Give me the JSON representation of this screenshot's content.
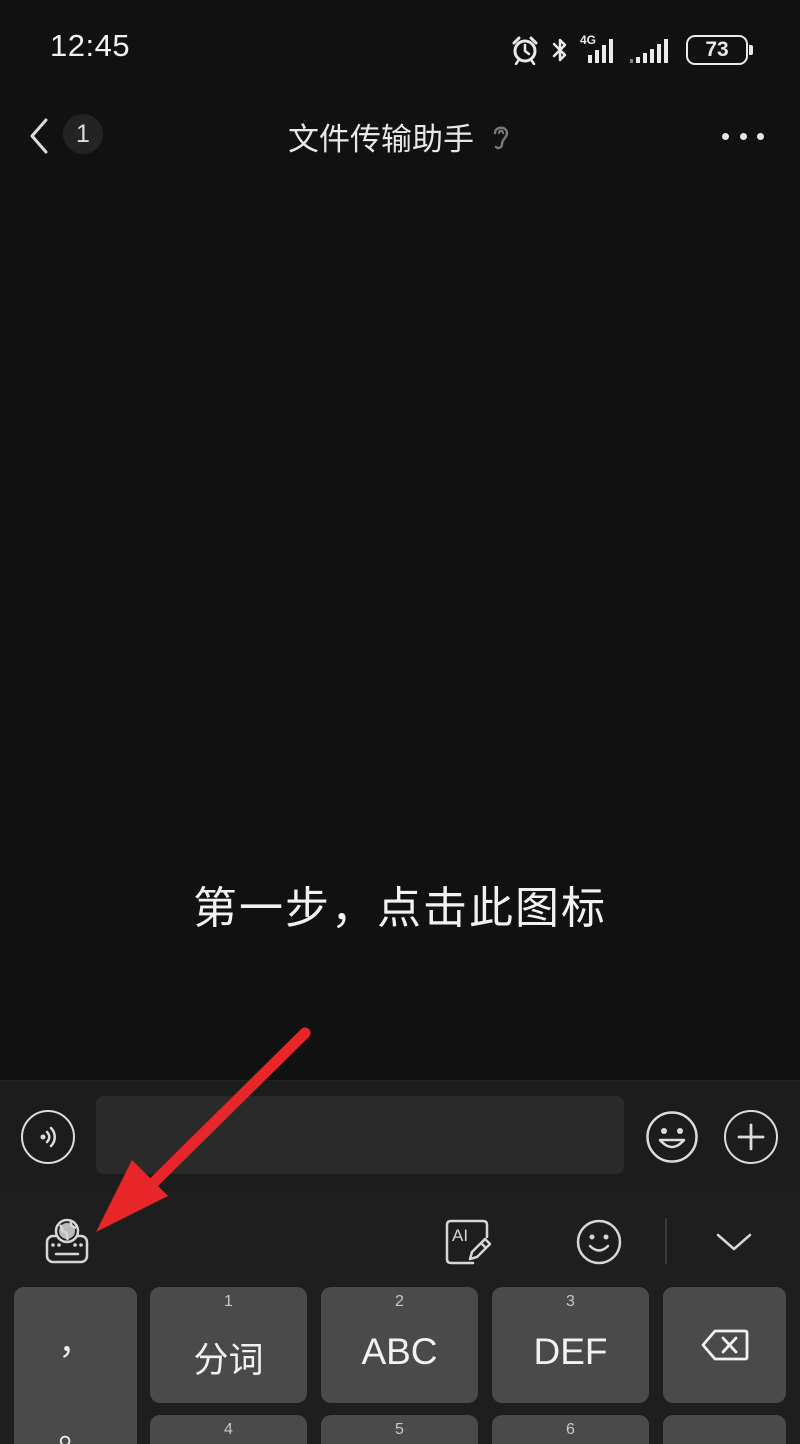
{
  "status_bar": {
    "time": "12:45",
    "network_label": "4G",
    "battery": "73",
    "icons": [
      "alarm-icon",
      "bluetooth-icon",
      "signal-4g-icon",
      "signal-icon",
      "battery-icon"
    ]
  },
  "header": {
    "back_icon": "chevron-left-icon",
    "unread_count": "1",
    "title": "文件传输助手",
    "title_icon": "ear-icon",
    "more_icon": "more-dots-icon"
  },
  "chat": {
    "instruction": "第一步，点击此图标"
  },
  "annotation": {
    "arrow_color": "#e8262a"
  },
  "input_bar": {
    "message_value": "",
    "voice_icon": "voice-icon",
    "emoji_icon": "emoji-icon",
    "plus_icon": "plus-icon"
  },
  "keyboard_toolbar": {
    "items": [
      "keyboard-language-icon",
      "ai-write-icon",
      "smiley-icon",
      "collapse-keyboard-icon"
    ]
  },
  "keyboard": {
    "punct_top": "，",
    "punct_bottom": "。",
    "row1": [
      {
        "num": "1",
        "label": "分词"
      },
      {
        "num": "2",
        "label": "ABC"
      },
      {
        "num": "3",
        "label": "DEF"
      }
    ],
    "row2_nums": [
      "4",
      "5",
      "6"
    ],
    "delete_icon": "backspace-icon"
  },
  "colors": {
    "background": "#111111",
    "input_bar": "#1c1c1c",
    "keyboard": "#1e1e1e",
    "key": "#4a4a4a",
    "arrow": "#e8262a"
  }
}
